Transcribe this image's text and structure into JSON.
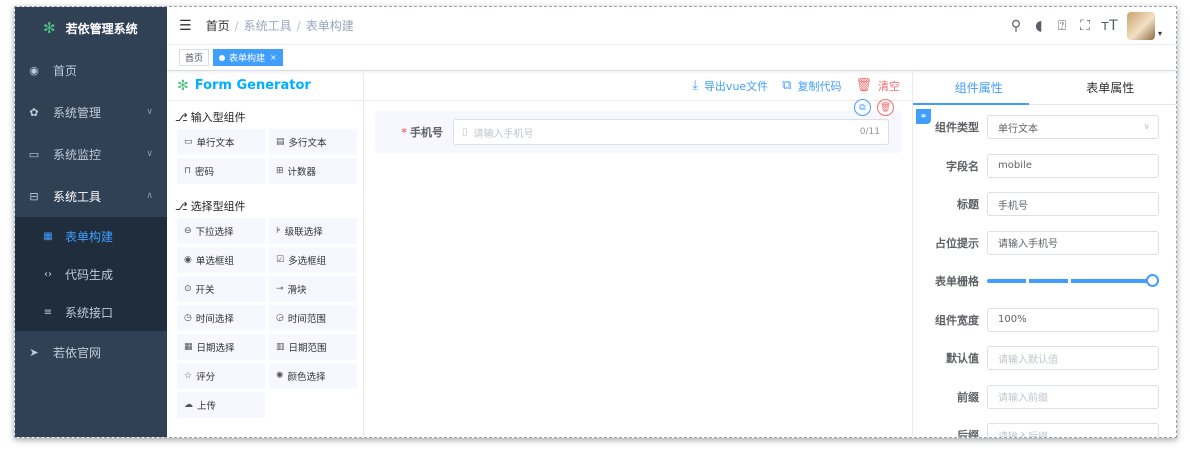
{
  "app": {
    "title": "若依管理系统"
  },
  "sidebar": {
    "items": [
      {
        "icon": "dashboard-icon",
        "label": "首页"
      },
      {
        "icon": "gear-icon",
        "label": "系统管理"
      },
      {
        "icon": "monitor-icon",
        "label": "系统监控"
      },
      {
        "icon": "toolbox-icon",
        "label": "系统工具"
      },
      {
        "icon": "send-icon",
        "label": "若依官网"
      }
    ],
    "submenu": [
      {
        "icon": "grid-icon",
        "label": "表单构建"
      },
      {
        "icon": "code-icon",
        "label": "代码生成"
      },
      {
        "icon": "swagger-icon",
        "label": "系统接口"
      }
    ]
  },
  "header": {
    "breadcrumb": [
      "首页",
      "系统工具",
      "表单构建"
    ]
  },
  "tags": [
    {
      "label": "首页"
    },
    {
      "label": "表单构建",
      "close": "×"
    }
  ],
  "generator": {
    "title": "Form Generator",
    "input_group": "输入型组件",
    "select_group": "选择型组件",
    "input_components": [
      "单行文本",
      "多行文本",
      "密码",
      "计数器"
    ],
    "select_components": [
      "下拉选择",
      "级联选择",
      "单选框组",
      "多选框组",
      "开关",
      "滑块",
      "时间选择",
      "时间范围",
      "日期选择",
      "日期范围",
      "评分",
      "颜色选择",
      "上传"
    ],
    "actions": {
      "export": "导出vue文件",
      "copy": "复制代码",
      "clear": "清空"
    },
    "field": {
      "required_mark": "*",
      "label": "手机号",
      "placeholder": "请输入手机号",
      "counter": "0/11"
    }
  },
  "panel": {
    "tabs": [
      "组件属性",
      "表单属性"
    ],
    "props": {
      "type_label": "组件类型",
      "type_value": "单行文本",
      "name_label": "字段名",
      "name_value": "mobile",
      "title_label": "标题",
      "title_value": "手机号",
      "placeholder_label": "占位提示",
      "placeholder_value": "请输入手机号",
      "span_label": "表单栅格",
      "width_label": "组件宽度",
      "width_value": "100%",
      "default_label": "默认值",
      "default_placeholder": "请输入默认值",
      "prefix_label": "前缀",
      "prefix_placeholder": "请输入前缀",
      "suffix_label": "后缀",
      "suffix_placeholder": "请输入后缀"
    },
    "span_value": 24,
    "span_max": 24
  },
  "colors": {
    "accent": "#409eff",
    "sidebar": "#304156",
    "danger": "#f56c6c"
  }
}
